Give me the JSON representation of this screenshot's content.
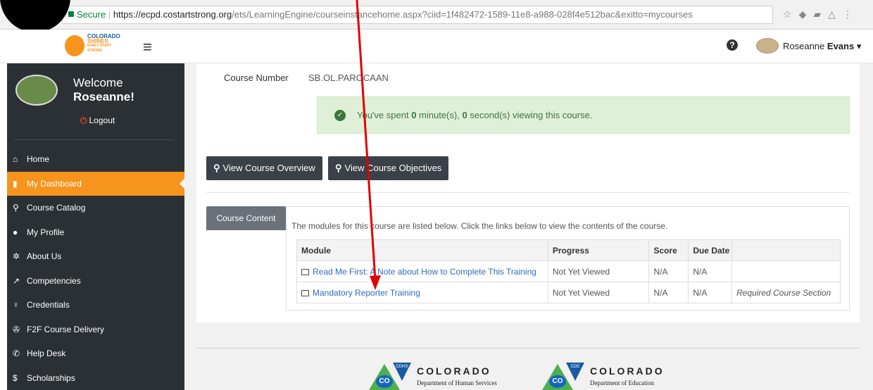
{
  "browser": {
    "secure_label": "Secure",
    "url_host": "https://ecpd.costartstrong.org",
    "url_path": "/ets/LearningEngine/courseinstancehome.aspx?ciid=1f482472-1589-11e8-a988-028f4e512bac&exitto=mycourses"
  },
  "topbar": {
    "brand_line1": "COLORADO",
    "brand_line2": "SHINES",
    "brand_line3": "EARLY START STRONG",
    "user_first": "Roseanne",
    "user_last": "Evans"
  },
  "sidebar": {
    "welcome": "Welcome",
    "user_name": "Roseanne",
    "logout": "Logout",
    "items": [
      {
        "label": "Home",
        "icon": "home-icon",
        "glyph": "⌂"
      },
      {
        "label": "My Dashboard",
        "icon": "book-icon",
        "glyph": "▮"
      },
      {
        "label": "Course Catalog",
        "icon": "search-icon",
        "glyph": "⚲"
      },
      {
        "label": "My Profile",
        "icon": "user-icon",
        "glyph": "●"
      },
      {
        "label": "About Us",
        "icon": "info-icon",
        "glyph": "✲"
      },
      {
        "label": "Competencies",
        "icon": "chart-icon",
        "glyph": "↗"
      },
      {
        "label": "Credentials",
        "icon": "credential-icon",
        "glyph": "♀"
      },
      {
        "label": "F2F Course Delivery",
        "icon": "flask-icon",
        "glyph": "✇"
      },
      {
        "label": "Help Desk",
        "icon": "phone-icon",
        "glyph": "✆"
      },
      {
        "label": "Scholarships",
        "icon": "dollar-icon",
        "glyph": "$"
      }
    ]
  },
  "course": {
    "number_label": "Course Number",
    "number_value": "SB.OL.PAROCAAN",
    "alert_prefix": "You've spent ",
    "minutes": "0",
    "alert_mid": " minute(s),  ",
    "seconds": "0",
    "alert_suffix": " second(s) viewing this course.",
    "btn_overview": "View Course Overview",
    "btn_objectives": "View Course Objectives",
    "content_tab": "Course Content",
    "content_desc": "The modules for this course are listed below. Click the links below to view the contents of the course."
  },
  "table": {
    "headers": [
      "Module",
      "Progress",
      "Score",
      "Due Date",
      ""
    ],
    "rows": [
      {
        "module": "Read Me First: A Note about How to Complete This Training",
        "progress": "Not Yet Viewed",
        "score": "N/A",
        "due": "N/A",
        "note": ""
      },
      {
        "module": "Mandatory Reporter Training",
        "progress": "Not Yet Viewed",
        "score": "N/A",
        "due": "N/A",
        "note": "Required Course Section"
      }
    ]
  },
  "footer": {
    "logo1_badge": "CDHS",
    "logo1_state": "COLORADO",
    "logo1_dept": "Department of Human Services",
    "logo2_badge": "CDE",
    "logo2_state": "COLORADO",
    "logo2_dept": "Department of Education",
    "co_mark": "CO"
  },
  "colors": {
    "sidebar_bg": "#2b3034",
    "accent": "#f7941d",
    "button": "#3b4148",
    "alert_bg": "#dff0d8",
    "annotation_arrow": "#e00000"
  }
}
